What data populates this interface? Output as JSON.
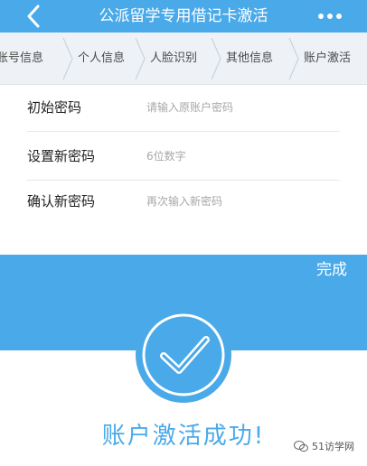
{
  "navbar": {
    "title": "公派留学专用借记卡激活",
    "back_icon": "chevron-left-icon",
    "more_icon": "more-dots-icon"
  },
  "steps": [
    {
      "label": "账号信息"
    },
    {
      "label": "个人信息"
    },
    {
      "label": "人脸识别"
    },
    {
      "label": "其他信息"
    },
    {
      "label": "账户激活"
    }
  ],
  "form": {
    "fields": [
      {
        "label": "初始密码",
        "placeholder": "请输入原账户密码"
      },
      {
        "label": "设置新密码",
        "placeholder": "6位数字"
      },
      {
        "label": "确认新密码",
        "placeholder": "再次输入新密码"
      }
    ]
  },
  "success": {
    "done_label": "完成",
    "message": "账户激活成功!",
    "icon": "check-circle-icon"
  },
  "watermark": {
    "text": "51访学网",
    "icon": "wechat-icon"
  },
  "colors": {
    "accent": "#4aa9e9",
    "step_bg": "#eef2f6"
  }
}
